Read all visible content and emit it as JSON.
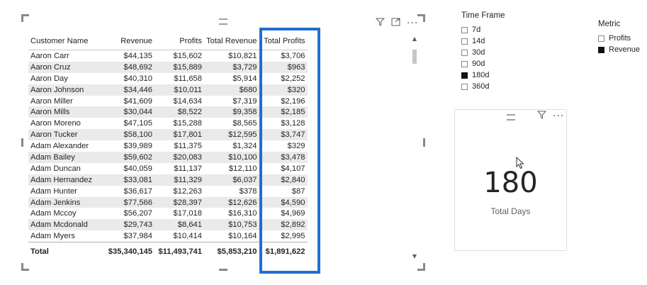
{
  "table": {
    "columns": [
      "Customer Name",
      "Revenue",
      "Profits",
      "Total Revenue",
      "Total Profits"
    ],
    "rows": [
      [
        "Aaron Carr",
        "$44,135",
        "$15,602",
        "$10,821",
        "$3,706"
      ],
      [
        "Aaron Cruz",
        "$48,692",
        "$15,889",
        "$3,729",
        "$963"
      ],
      [
        "Aaron Day",
        "$40,310",
        "$11,658",
        "$5,914",
        "$2,252"
      ],
      [
        "Aaron Johnson",
        "$34,446",
        "$10,011",
        "$680",
        "$320"
      ],
      [
        "Aaron Miller",
        "$41,609",
        "$14,634",
        "$7,319",
        "$2,196"
      ],
      [
        "Aaron Mills",
        "$30,044",
        "$8,522",
        "$9,358",
        "$2,185"
      ],
      [
        "Aaron Moreno",
        "$47,105",
        "$15,288",
        "$8,565",
        "$3,128"
      ],
      [
        "Aaron Tucker",
        "$58,100",
        "$17,801",
        "$12,595",
        "$3,747"
      ],
      [
        "Adam Alexander",
        "$39,989",
        "$11,375",
        "$1,324",
        "$329"
      ],
      [
        "Adam Bailey",
        "$59,602",
        "$20,083",
        "$10,100",
        "$3,478"
      ],
      [
        "Adam Duncan",
        "$40,059",
        "$11,137",
        "$12,110",
        "$4,107"
      ],
      [
        "Adam Hernandez",
        "$33,081",
        "$11,329",
        "$6,037",
        "$2,840"
      ],
      [
        "Adam Hunter",
        "$36,617",
        "$12,263",
        "$378",
        "$87"
      ],
      [
        "Adam Jenkins",
        "$77,566",
        "$28,397",
        "$12,626",
        "$4,590"
      ],
      [
        "Adam Mccoy",
        "$56,207",
        "$17,018",
        "$16,310",
        "$4,969"
      ],
      [
        "Adam Mcdonald",
        "$29,743",
        "$8,641",
        "$10,753",
        "$2,892"
      ],
      [
        "Adam Myers",
        "$37,984",
        "$10,414",
        "$10,164",
        "$2,995"
      ]
    ],
    "total": [
      "Total",
      "$35,340,145",
      "$11,493,741",
      "$5,853,210",
      "$1,891,622"
    ]
  },
  "time_frame": {
    "title": "Time Frame",
    "items": [
      {
        "label": "7d",
        "checked": false
      },
      {
        "label": "14d",
        "checked": false
      },
      {
        "label": "30d",
        "checked": false
      },
      {
        "label": "90d",
        "checked": false
      },
      {
        "label": "180d",
        "checked": true
      },
      {
        "label": "360d",
        "checked": false
      }
    ]
  },
  "metric": {
    "title": "Metric",
    "items": [
      {
        "label": "Profits",
        "checked": false
      },
      {
        "label": "Revenue",
        "checked": true
      }
    ]
  },
  "card": {
    "value": "180",
    "label": "Total Days"
  },
  "icons": {
    "filter": "filter-icon",
    "focus": "focus-mode-icon",
    "more": "more-options-icon"
  },
  "colors": {
    "highlight": "#1e6fd0",
    "alt_row": "#eaeaea"
  }
}
